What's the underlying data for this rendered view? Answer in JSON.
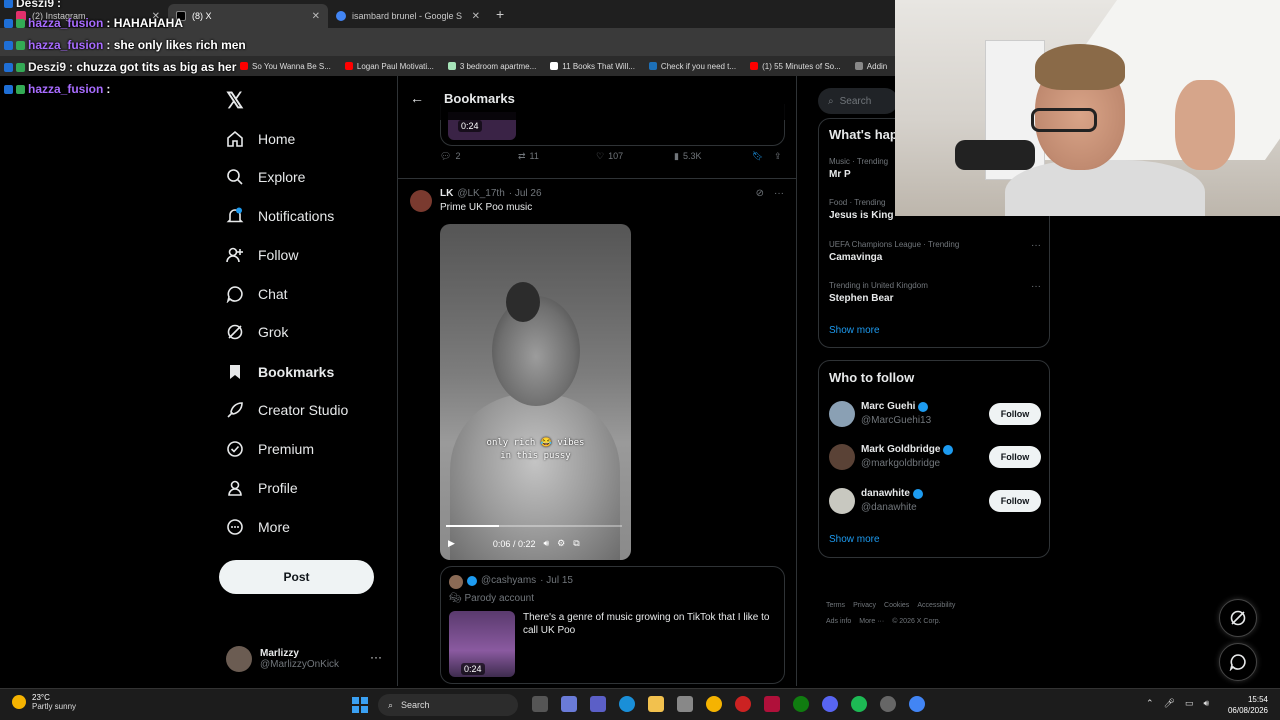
{
  "browser": {
    "tabs": [
      {
        "label": "(2) Instagram",
        "color": "#e1306c"
      },
      {
        "label": "(8) X",
        "color": "#000000",
        "active": true
      },
      {
        "label": "isambard brunel - Google Search",
        "color": "#4285f4"
      }
    ],
    "new_tab": "+",
    "bookmarks": [
      {
        "label": "So You Wanna Be S...",
        "color": "#ff0000"
      },
      {
        "label": "Logan Paul Motivati...",
        "color": "#ff0000"
      },
      {
        "label": "3 bedroom apartme...",
        "color": "#a6e3b8"
      },
      {
        "label": "11 Books That Will...",
        "color": "#ffffff"
      },
      {
        "label": "Check if you need t...",
        "color": "#1d70b8"
      },
      {
        "label": "(1) 55 Minutes of So...",
        "color": "#ff0000"
      },
      {
        "label": "Addin",
        "color": "#888888"
      }
    ]
  },
  "chat": [
    {
      "user": "Deszi9",
      "msg": ":",
      "user_color": "#f0f0f0"
    },
    {
      "user": "hazza_fusion",
      "msg": ": HAHAHAHA",
      "user_color": "#a86cff"
    },
    {
      "user": "hazza_fusion",
      "msg": ": she only likes rich men",
      "user_color": "#a86cff"
    },
    {
      "user": "Deszi9",
      "msg": ": chuzza got tits as big as her",
      "user_color": "#f0f0f0"
    },
    {
      "user": "hazza_fusion",
      "msg": ":",
      "user_color": "#a86cff"
    }
  ],
  "nav": {
    "items": [
      {
        "label": "Home",
        "icon": "home-icon"
      },
      {
        "label": "Explore",
        "icon": "search-icon"
      },
      {
        "label": "Notifications",
        "icon": "bell-icon"
      },
      {
        "label": "Follow",
        "icon": "add-person-icon"
      },
      {
        "label": "Chat",
        "icon": "chat-icon"
      },
      {
        "label": "Grok",
        "icon": "grok-icon"
      },
      {
        "label": "Bookmarks",
        "icon": "bookmark-icon"
      },
      {
        "label": "Creator Studio",
        "icon": "rocket-icon"
      },
      {
        "label": "Premium",
        "icon": "premium-icon"
      },
      {
        "label": "Profile",
        "icon": "profile-icon"
      },
      {
        "label": "More",
        "icon": "more-icon"
      }
    ],
    "post_label": "Post",
    "account": {
      "name": "Marlizzy",
      "handle": "@MarlizzyOnKick",
      "more": "···"
    }
  },
  "main": {
    "title": "Bookmarks",
    "top_quote": {
      "duration": "0:24"
    },
    "actions": {
      "replies": "2",
      "reposts": "11",
      "likes": "107",
      "views": "5.3K"
    },
    "tweet": {
      "name": "LK",
      "handle": "@LK_17th",
      "date": "· Jul 26",
      "text": "Prime UK Poo music",
      "video": {
        "caption_line1": "only rich 😂 vibes",
        "caption_line2": "in this pussy",
        "time": "0:06 / 0:22",
        "progress": 0.3
      },
      "quote": {
        "handle": "@cashyams",
        "date": "· Jul 15",
        "label": "Parody account",
        "text": "There's a genre of music growing on TikTok that I like to call UK Poo",
        "duration": "0:24"
      }
    }
  },
  "right": {
    "search_placeholder": "Search",
    "trends_title": "What's hap",
    "trends": [
      {
        "category": "Music · Trending",
        "name": "Mr P"
      },
      {
        "category": "Food · Trending",
        "name": "Jesus is King"
      },
      {
        "category": "UEFA Champions League · Trending",
        "name": "Camavinga"
      },
      {
        "category": "Trending in United Kingdom",
        "name": "Stephen Bear"
      }
    ],
    "trends_more": "Show more",
    "who_title": "Who to follow",
    "people": [
      {
        "name": "Marc Guehi",
        "handle": "@MarcGuehi13",
        "button": "Follow",
        "color": "#8aa0b4"
      },
      {
        "name": "Mark Goldbridge",
        "handle": "@markgoldbridge",
        "button": "Follow",
        "color": "#5a4236"
      },
      {
        "name": "danawhite",
        "handle": "@danawhite",
        "button": "Follow",
        "color": "#c8c8c0"
      }
    ],
    "who_more": "Show more",
    "footer": [
      "Terms",
      "Privacy",
      "Cookies",
      "Accessibility",
      "Ads info",
      "More ···",
      "© 2026 X Corp."
    ]
  },
  "taskbar": {
    "temp": "23°C",
    "weather": "Partly sunny",
    "search": "Search",
    "time": "15:54",
    "date": "06/08/2026"
  }
}
